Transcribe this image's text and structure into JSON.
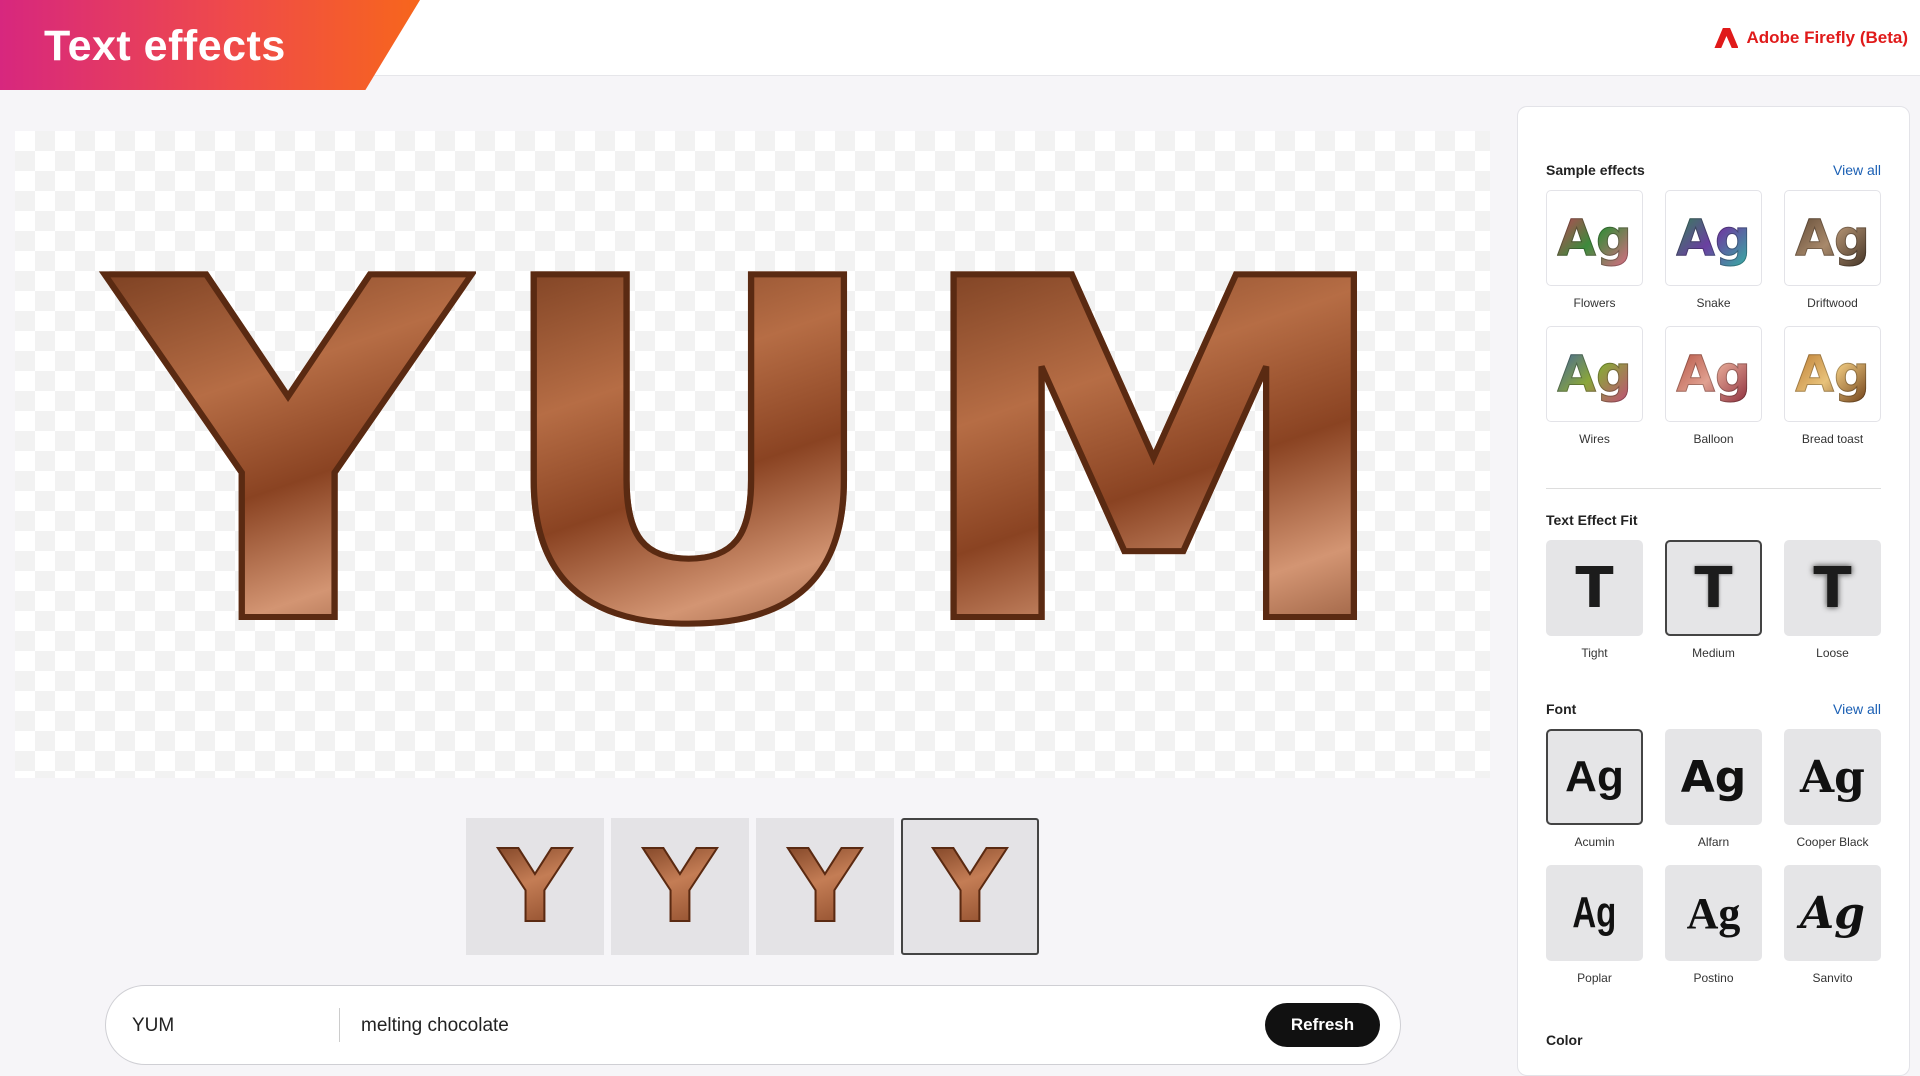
{
  "header": {
    "title": "Text effects",
    "brand": "Adobe Firefly (Beta)"
  },
  "canvas": {
    "letters": [
      "Y",
      "U",
      "M"
    ]
  },
  "variations": {
    "items": [
      "Y",
      "Y",
      "Y",
      "Y"
    ],
    "selected_index": 3
  },
  "prompt": {
    "text": "YUM",
    "prompt": "melting chocolate",
    "refresh_label": "Refresh"
  },
  "panel": {
    "sample_effects": {
      "title": "Sample effects",
      "view_all": "View all",
      "items": [
        {
          "label": "Flowers",
          "glyph": "Ag",
          "gradient": "#d03b5a,#3d8a3c,#e66a8a"
        },
        {
          "label": "Snake",
          "glyph": "Ag",
          "gradient": "#2d8a4e,#6a3fa0,#34b7a5"
        },
        {
          "label": "Driftwood",
          "glyph": "Ag",
          "gradient": "#5a4330,#a8896b,#3e2f22"
        },
        {
          "label": "Wires",
          "glyph": "Ag",
          "gradient": "#3a5fa8,#8aa63a,#c44a7a"
        },
        {
          "label": "Balloon",
          "glyph": "Ag",
          "gradient": "#b04a3a,#e0a090,#8a2a3a"
        },
        {
          "label": "Bread toast",
          "glyph": "Ag",
          "gradient": "#b8742a,#e8c27a,#6a3a14"
        }
      ]
    },
    "fit": {
      "title": "Text Effect Fit",
      "glyph": "T",
      "selected": "Medium",
      "items": [
        "Tight",
        "Medium",
        "Loose"
      ]
    },
    "font": {
      "title": "Font",
      "view_all": "View all",
      "glyph": "Ag",
      "selected": "Acumin",
      "items": [
        "Acumin",
        "Alfarn",
        "Cooper Black",
        "Poplar",
        "Postino",
        "Sanvito"
      ]
    },
    "color": {
      "title": "Color"
    }
  }
}
